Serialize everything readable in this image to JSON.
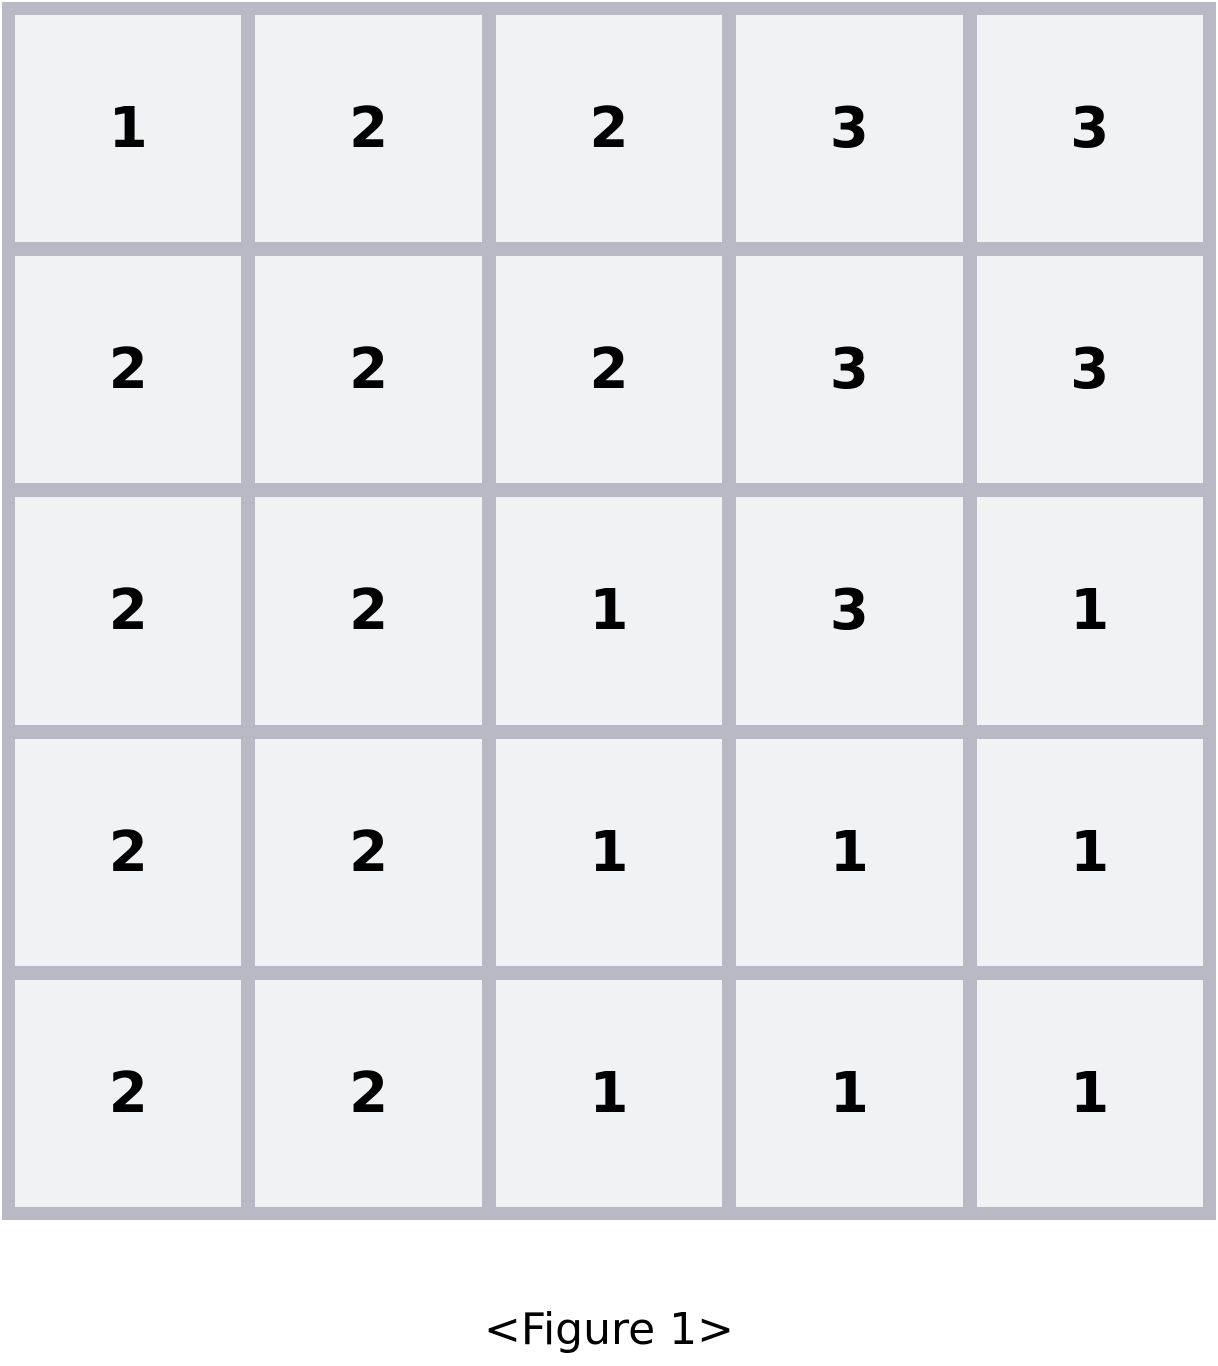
{
  "grid": {
    "rows": [
      [
        "1",
        "2",
        "2",
        "3",
        "3"
      ],
      [
        "2",
        "2",
        "2",
        "3",
        "3"
      ],
      [
        "2",
        "2",
        "1",
        "3",
        "1"
      ],
      [
        "2",
        "2",
        "1",
        "1",
        "1"
      ],
      [
        "2",
        "2",
        "1",
        "1",
        "1"
      ]
    ]
  },
  "caption": "<Figure 1>",
  "colors": {
    "grid_line": "#b9b9c6",
    "cell_fill": "#f1f2f4",
    "text": "#000000"
  }
}
